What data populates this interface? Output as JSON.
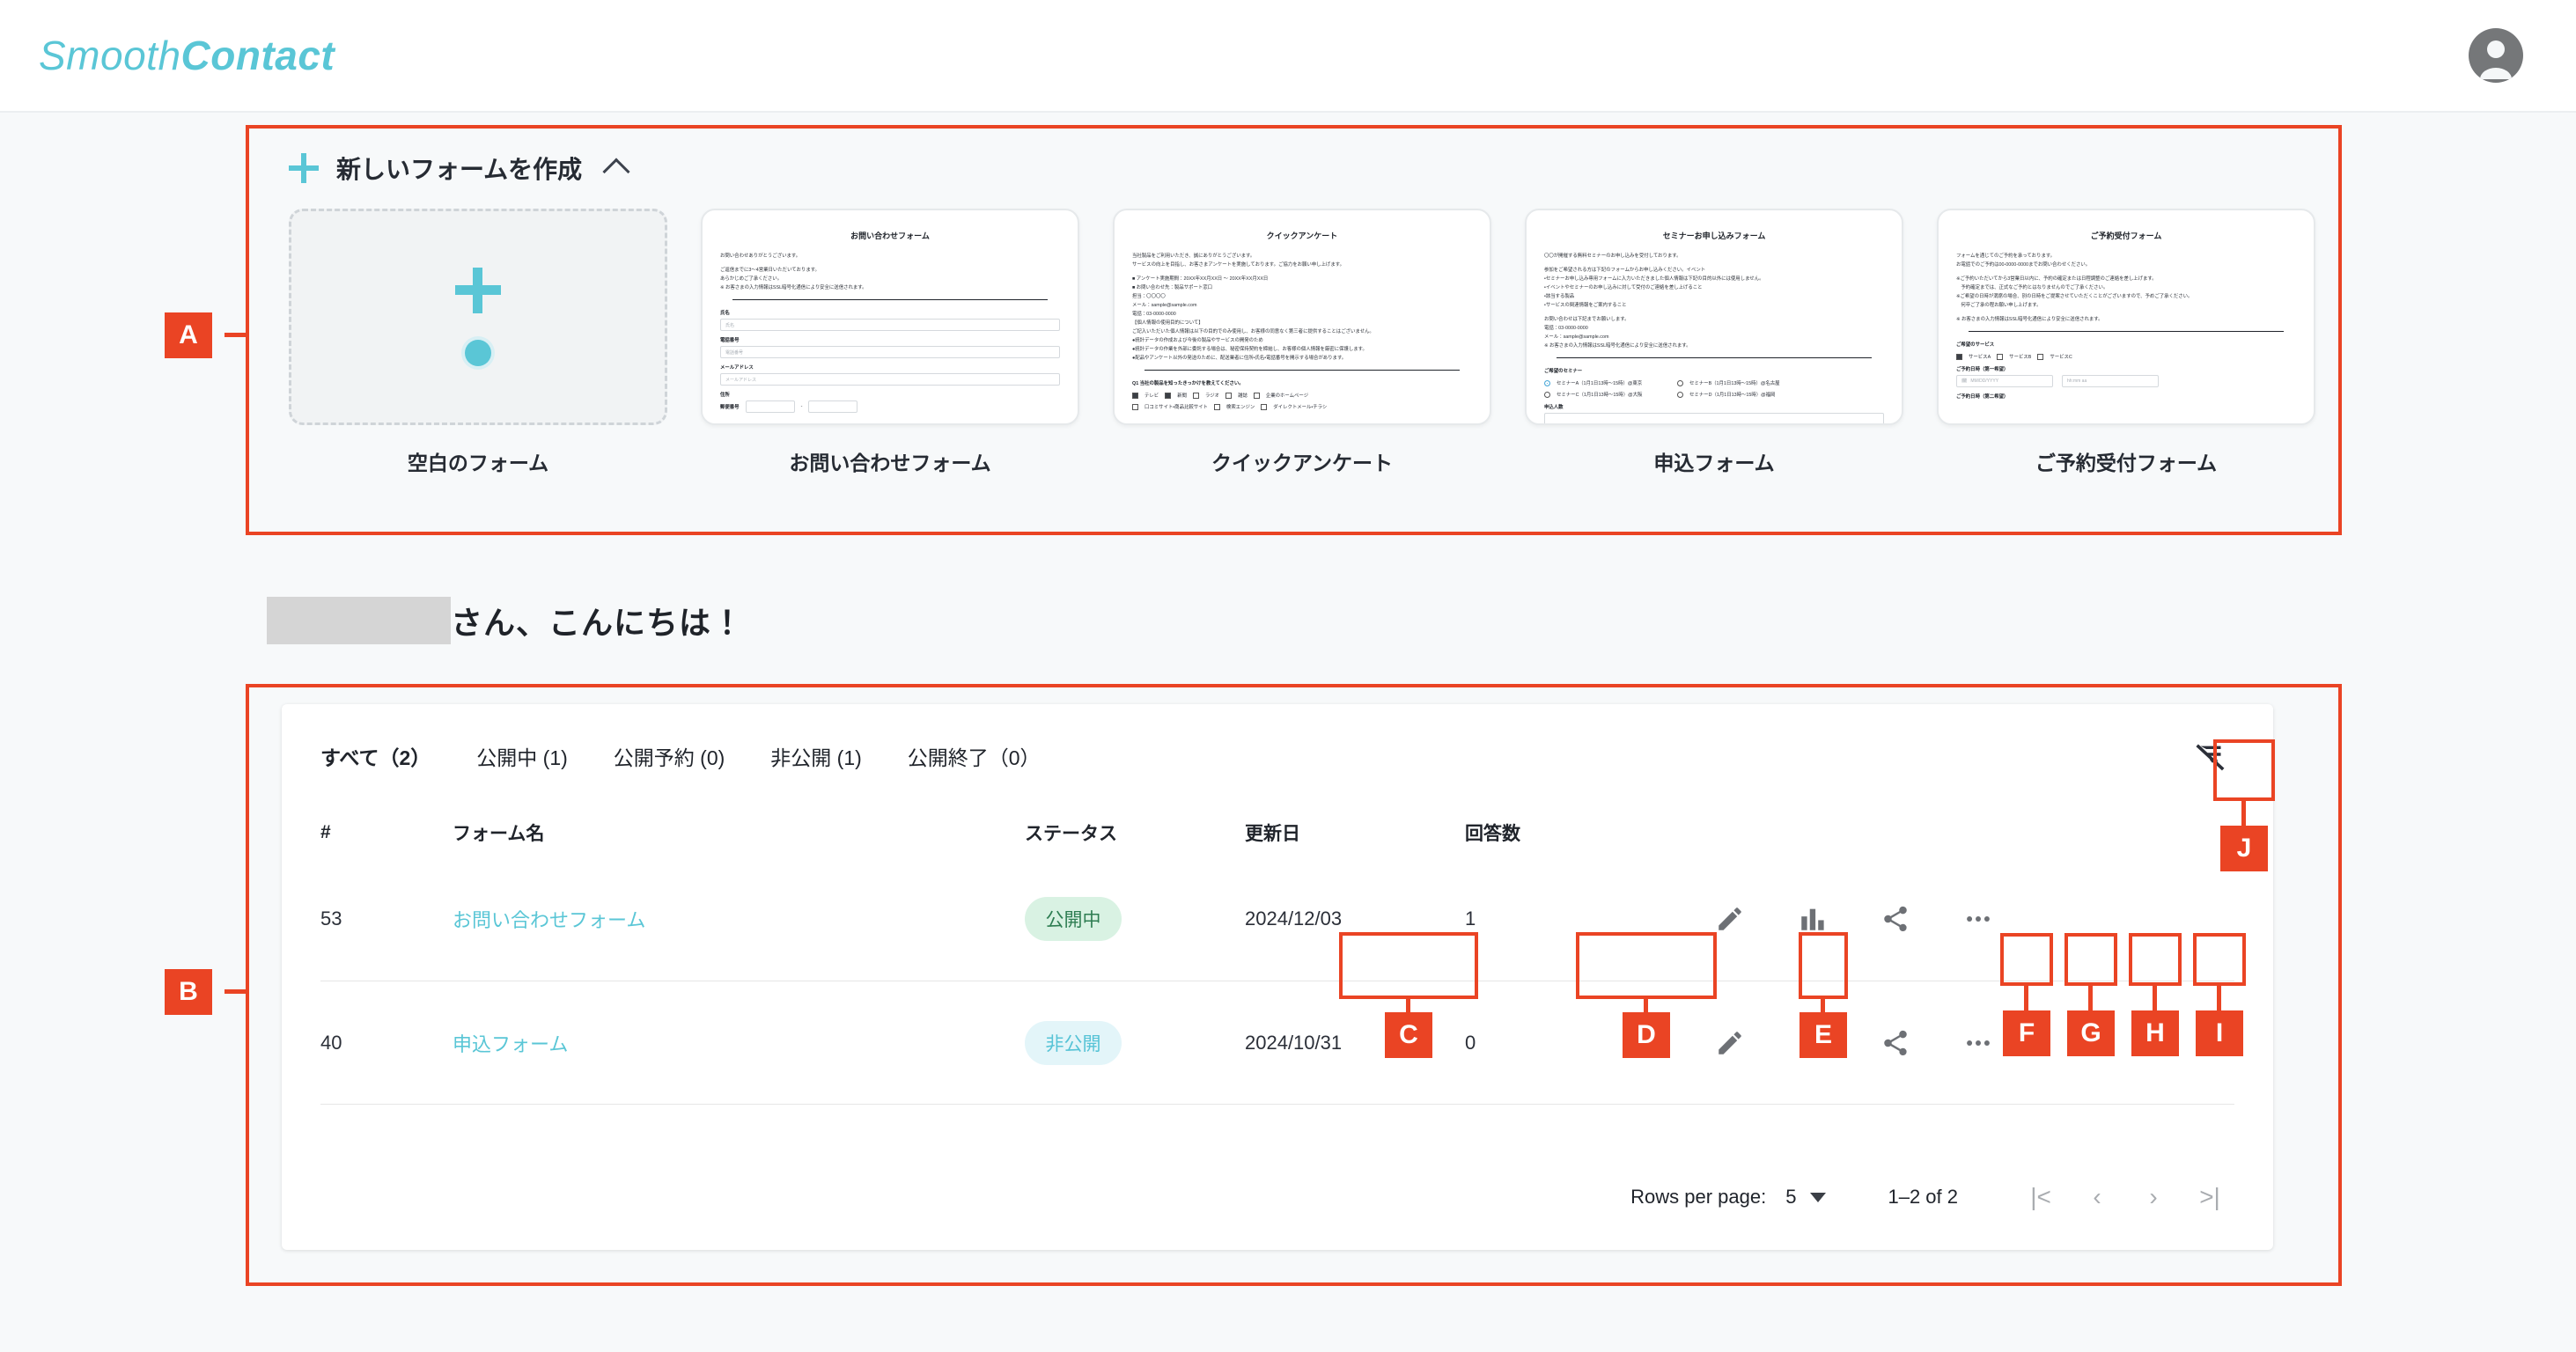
{
  "brand": {
    "name_light": "Smooth",
    "name_bold": "Contact",
    "accent": "#5ac6d6",
    "annotation_color": "#ea4424"
  },
  "header": {
    "avatar_icon": "account-circle-icon"
  },
  "creator": {
    "title": "新しいフォームを作成",
    "plus_icon": "plus-icon",
    "collapse_icon": "chevron-up-icon",
    "cards": [
      {
        "label": "空白のフォーム",
        "blank": true,
        "plus_icon": "plus-icon",
        "dot_icon": "circle-dot-icon"
      },
      {
        "label": "お問い合わせフォーム",
        "preview": {
          "title": "お問い合わせフォーム",
          "paragraphs": [
            "お問い合わせありがとうございます。",
            "ご返信までに3〜4営業日いただいております。\nあらかじめご了承ください。\n※ お客さまの入力情報はSSL暗号化通信により安全に送信されます。"
          ],
          "fields": [
            {
              "label": "氏名",
              "placeholder": "氏名"
            },
            {
              "label": "電話番号",
              "placeholder": "電話番号"
            },
            {
              "label": "メールアドレス",
              "placeholder": "メールアドレス"
            }
          ],
          "addr_label": "住所",
          "zip_label": "郵便番号"
        }
      },
      {
        "label": "クイックアンケート",
        "preview": {
          "title": "クイックアンケート",
          "paragraphs": [
            "当社製品をご利用いただき、誠にありがとうございます。\nサービスの向上を目指し、お客さまアンケートを実施しております。ご協力をお願い申し上げます。",
            "■ アンケート実施期間：20XX年XX月XX日 〜 20XX年XX月XX日\n■ お問い合わせ先：製品サポート窓口\n担当：〇〇〇〇\nメール：sample@sample.com\n電話：03-0000-0000\n【個人情報の使用目的について】\nご記入いただいた個人情報は以下の目的でのみ使用し、お客様の同意なく第三者に提供することはございません。\n●統計データの作成および今後の製品やサービスの開発のため\n●統計データの作業を外部に委託する場合は、秘密保持契約を締結し、お客様の個人情報を厳密に保護します。\n●配品やアンケート以外の発送のために、配送業者に住所・氏名・電話番号を開示する場合があります。"
          ],
          "question": "Q1 当社の製品を知ったきっかけを教えてください。",
          "choices_row1": [
            "テレビ",
            "新聞",
            "ラジオ",
            "雑誌",
            "企業のホームページ"
          ],
          "choices_row2": [
            "口コミサイト・商品比較サイト",
            "検索エンジン",
            "ダイレクトメール・チラシ"
          ],
          "checked": [
            0,
            1
          ]
        }
      },
      {
        "label": "申込フォーム",
        "preview": {
          "title": "セミナーお申し込みフォーム",
          "paragraphs": [
            "〇〇が開催する無料セミナーのお申し込みを受付しております。",
            "参加をご希望される方は下記のフォームからお申し込みください。イベント\n・セミナーお申し込み専用フォームに入力いただきました個人情報は下記の目的以外には使用しません。\n・イベントやセミナーのお申し込みに対して受付のご連絡を差し上げること\n・該当する製品\n・サービスの関連情報をご案内すること",
            "お問い合わせは下記までお願いします。\n電話：03-0000-0000\nメール：sample@sample.com\n※ お客さまの入力情報はSSL暗号化通信により安全に送信されます。"
          ],
          "radio_label": "ご希望のセミナー",
          "radios": [
            "セミナーA（1月1日13時〜15時）@東京",
            "セミナーB（1月1日13時〜15時）@名古屋",
            "セミナーC（1月1日13時〜15時）@大阪",
            "セミナーD（1月1日13時〜15時）@福岡"
          ],
          "count_label": "申込人数"
        }
      },
      {
        "label": "ご予約受付フォーム",
        "preview": {
          "title": "ご予約受付フォーム",
          "paragraphs": [
            "フォームを通じてのご予約を承っております。\nお電話でのご予約は00-0000-0000までお問い合わせください。",
            "※ご予約いただいてから3営業日以内に、予約の確定または日程調整のご連絡を差し上げます。\n　予約確定までは、正式なご予約とはなりませんのでご了承ください。\n※ご希望の日時が満席の場合、別の日時をご提案させていただくことがございますので、予めご了承ください。\n　何卒ご了承の程お願い申し上げます。",
            "※ お客さまの入力情報はSSL暗号化通信により安全に送信されます。"
          ],
          "service_label": "ご希望のサービス",
          "services": [
            "サービスA",
            "サービスB",
            "サービスC"
          ],
          "date1_label": "ご予約日時（第一希望）",
          "date2_label": "ご予約日時（第二希望）",
          "date_placeholder": "MM/DD/YYYY",
          "time_placeholder": "hh:mm aa",
          "calendar_icon": "calendar-icon"
        }
      }
    ]
  },
  "greeting": {
    "redacted_user": "",
    "text": "さん、こんにちは！"
  },
  "list": {
    "tabs": [
      {
        "label": "すべて（2）",
        "active": true
      },
      {
        "label": "公開中 (1)",
        "active": false
      },
      {
        "label": "公開予約 (0)",
        "active": false
      },
      {
        "label": "非公開 (1)",
        "active": false
      },
      {
        "label": "公開終了（0）",
        "active": false
      }
    ],
    "filter_off_icon": "filter-off-icon",
    "columns": [
      "#",
      "フォーム名",
      "ステータス",
      "更新日",
      "回答数"
    ],
    "rows": [
      {
        "id": "53",
        "name": "お問い合わせフォーム",
        "status": "公開中",
        "status_kind": "pub",
        "updated": "2024/12/03",
        "answers": "1",
        "actions": [
          "edit-icon",
          "chart-icon",
          "share-icon",
          "more-icon"
        ]
      },
      {
        "id": "40",
        "name": "申込フォーム",
        "status": "非公開",
        "status_kind": "priv",
        "updated": "2024/10/31",
        "answers": "0",
        "actions": [
          "edit-icon",
          "chart-icon",
          "share-icon",
          "more-icon"
        ]
      }
    ],
    "pagination": {
      "rows_per_page_label": "Rows per page:",
      "rows_per_page_value": "5",
      "range": "1–2 of 2",
      "first_icon": "|<",
      "prev_icon": "‹",
      "next_icon": "›",
      "last_icon": ">|"
    }
  },
  "annotations": [
    {
      "id": "A",
      "target": "template-picker-section"
    },
    {
      "id": "B",
      "target": "forms-list-section"
    },
    {
      "id": "C",
      "target": "status-badge"
    },
    {
      "id": "D",
      "target": "updated-date"
    },
    {
      "id": "E",
      "target": "answer-count"
    },
    {
      "id": "F",
      "target": "edit-button"
    },
    {
      "id": "G",
      "target": "chart-button"
    },
    {
      "id": "H",
      "target": "share-button"
    },
    {
      "id": "I",
      "target": "more-button"
    },
    {
      "id": "J",
      "target": "filter-off-button"
    }
  ]
}
